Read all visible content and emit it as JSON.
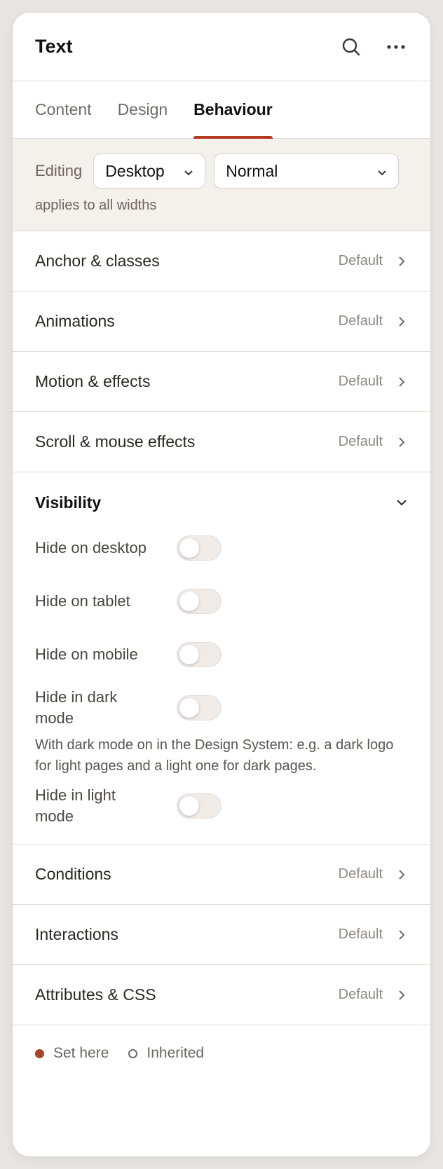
{
  "header": {
    "title": "Text",
    "search_icon": "search-icon",
    "more_icon": "more-horizontal-icon"
  },
  "tabs": [
    {
      "label": "Content",
      "active": false
    },
    {
      "label": "Design",
      "active": false
    },
    {
      "label": "Behaviour",
      "active": true
    }
  ],
  "editing": {
    "label": "Editing",
    "device_value": "Desktop",
    "state_value": "Normal",
    "note": "applies to all widths"
  },
  "sections_top": [
    {
      "label": "Anchor & classes",
      "status": "Default"
    },
    {
      "label": "Animations",
      "status": "Default"
    },
    {
      "label": "Motion & effects",
      "status": "Default"
    },
    {
      "label": "Scroll & mouse effects",
      "status": "Default"
    }
  ],
  "visibility": {
    "title": "Visibility",
    "toggles": [
      {
        "label": "Hide on desktop",
        "on": false
      },
      {
        "label": "Hide on tablet",
        "on": false
      },
      {
        "label": "Hide on mobile",
        "on": false
      },
      {
        "label": "Hide in dark mode",
        "on": false
      },
      {
        "label": "Hide in light mode",
        "on": false
      }
    ],
    "dark_mode_note": "With dark mode on in the Design System: e.g. a dark logo for light pages and a light one for dark pages."
  },
  "sections_bottom": [
    {
      "label": "Conditions",
      "status": "Default"
    },
    {
      "label": "Interactions",
      "status": "Default"
    },
    {
      "label": "Attributes & CSS",
      "status": "Default"
    }
  ],
  "legend": {
    "set_here": "Set here",
    "inherited": "Inherited"
  },
  "colors": {
    "accent": "#b23a22",
    "set_dot": "#a6442a",
    "editing_bg": "#f4f0ec"
  }
}
